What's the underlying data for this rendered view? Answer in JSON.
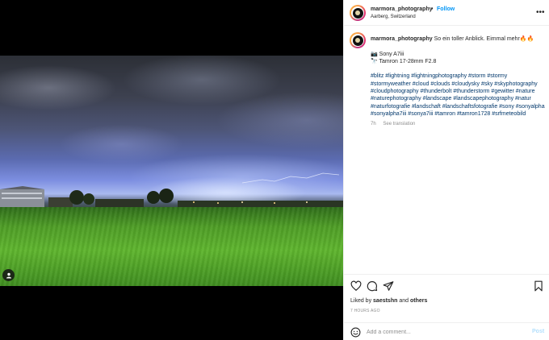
{
  "post": {
    "username": "marmora_photography",
    "separator": "•",
    "follow_label": "Follow",
    "location": "Aarberg, Switzerland",
    "more_icon": "more-horizontal-icon"
  },
  "caption": {
    "username": "marmora_photography",
    "text": "So ein toller Anblick. Eimmal mehr🔥🔥",
    "camera": "📷 Sony A7iii",
    "lens": "🔭 Tamron 17-28mm F2.8",
    "hashtags": "#blitz #lightning #lightningphotography #storm #stormy #stormyweather #cloud #clouds #cloudysky #sky #skyphotography #cloudphotography #thunderbolt #thunderstorm #gewitter #nature #naturephotography #landscape #landscapephotography #natur #naturfotografie #landschaft #landschaftsfotografie #sony #sonyalpha #sonyalpha7iii #sonya7iii #tamron #tamron1728 #srfmeteobild",
    "age": "7h",
    "see_translation": "See translation"
  },
  "actions": {
    "like_icon": "heart-icon",
    "comment_icon": "comment-icon",
    "share_icon": "send-icon",
    "save_icon": "bookmark-icon",
    "likes_prefix": "Liked by",
    "liked_user": "saestshn",
    "likes_mid": "and",
    "likes_others": "others",
    "time_ago": "7 HOURS AGO"
  },
  "comment": {
    "emoji_icon": "emoji-icon",
    "placeholder": "Add a comment...",
    "post_label": "Post"
  },
  "colors": {
    "accent": "#0095f6",
    "hashtag": "#00376b",
    "muted": "#8e8e8e",
    "post_disabled": "#b2dffc"
  }
}
